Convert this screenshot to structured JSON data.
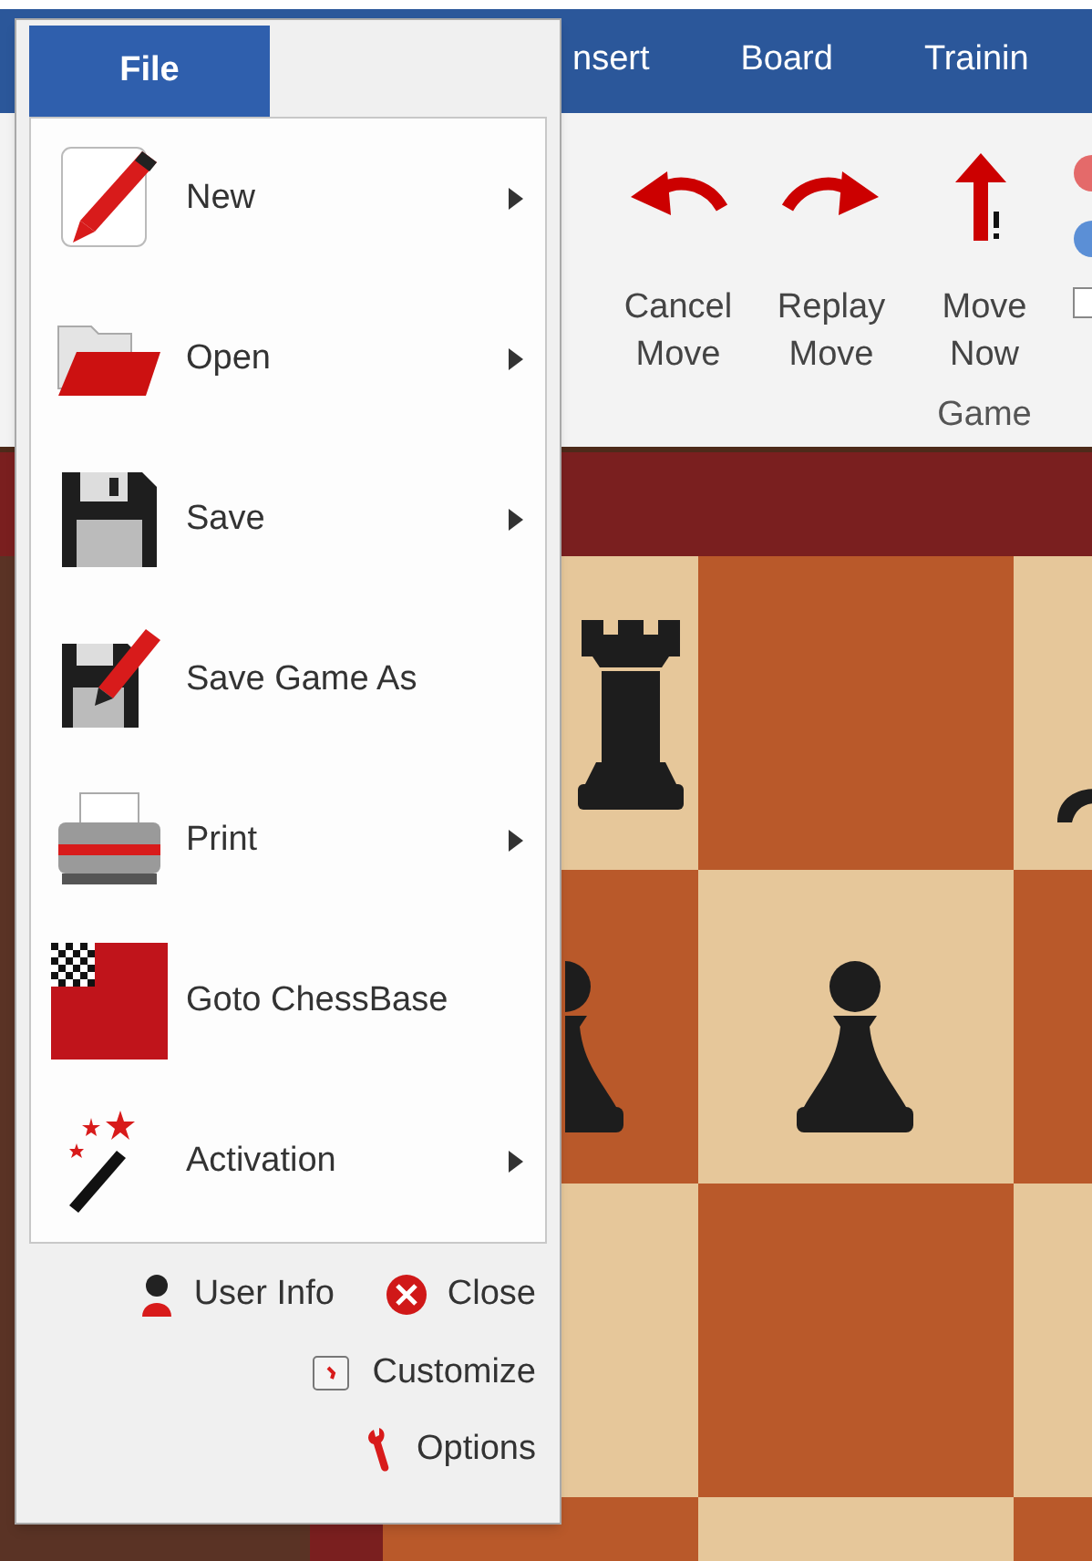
{
  "ribbon": {
    "tabs": [
      {
        "label": "nsert"
      },
      {
        "label": "Board"
      },
      {
        "label": "Trainin"
      }
    ],
    "buttons": [
      {
        "label": "Cancel Move",
        "kind": "undo"
      },
      {
        "label": "Replay Move",
        "kind": "redo"
      },
      {
        "label": "Move Now",
        "kind": "move_now"
      }
    ],
    "group_label": "Game"
  },
  "file_menu": {
    "tab": {
      "label": "File",
      "selected": true
    },
    "items": [
      {
        "label": "New",
        "kind": "new",
        "submenu": true
      },
      {
        "label": "Open",
        "kind": "open",
        "submenu": true
      },
      {
        "label": "Save",
        "kind": "save",
        "submenu": true
      },
      {
        "label": "Save Game As",
        "kind": "save_as",
        "submenu": false
      },
      {
        "label": "Print",
        "kind": "print",
        "submenu": true
      },
      {
        "label": "Goto ChessBase",
        "kind": "chessbase",
        "submenu": false
      },
      {
        "label": "Activation",
        "kind": "activation",
        "submenu": true
      }
    ],
    "footer_rows": [
      {
        "items": [
          {
            "label": "User Info",
            "kind": "user"
          },
          {
            "label": "Close",
            "kind": "close"
          }
        ]
      },
      {
        "items": [
          {
            "label": "Customize",
            "kind": "customize"
          }
        ]
      },
      {
        "items": [
          {
            "label": "Options",
            "kind": "wrench"
          }
        ]
      }
    ]
  }
}
